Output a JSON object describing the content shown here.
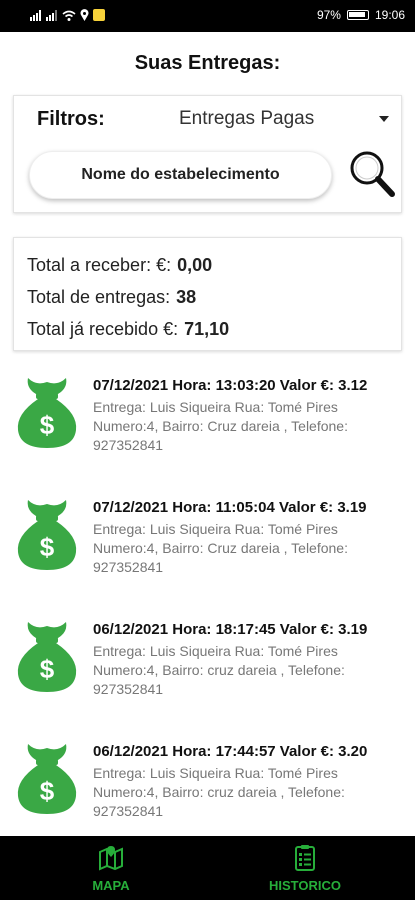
{
  "status_bar": {
    "battery": "97%",
    "time": "19:06"
  },
  "title": "Suas Entregas:",
  "filters": {
    "label": "Filtros:",
    "selected": "Entregas Pagas",
    "search_placeholder": "Nome do estabelecimento"
  },
  "totals": {
    "to_receive_label": "Total a receber: €:",
    "to_receive_value": "0,00",
    "deliveries_label": "Total de entregas:",
    "deliveries_value": "38",
    "received_label": "Total já recebido €:",
    "received_value": "71,10"
  },
  "deliveries": [
    {
      "header": "07/12/2021 Hora: 13:03:20 Valor €: 3.12",
      "detail": "Entrega: Luis Siqueira   Rua: Tomé Pires Numero:4, Bairro: Cruz dareia , Telefone: 927352841"
    },
    {
      "header": "07/12/2021 Hora: 11:05:04 Valor €: 3.19",
      "detail": "Entrega: Luis Siqueira   Rua: Tomé Pires Numero:4, Bairro: Cruz dareia , Telefone: 927352841"
    },
    {
      "header": "06/12/2021 Hora: 18:17:45 Valor €: 3.19",
      "detail": "Entrega: Luis Siqueira   Rua: Tomé Pires Numero:4, Bairro: cruz dareia , Telefone: 927352841"
    },
    {
      "header": "06/12/2021 Hora: 17:44:57 Valor €: 3.20",
      "detail": "Entrega: Luis Siqueira   Rua: Tomé Pires Numero:4, Bairro: cruz dareia , Telefone: 927352841"
    }
  ],
  "nav": {
    "map_label": "MAPA",
    "history_label": "HISTORICO"
  },
  "colors": {
    "accent_green": "#27ae3a",
    "bag_green": "#3aa845"
  }
}
